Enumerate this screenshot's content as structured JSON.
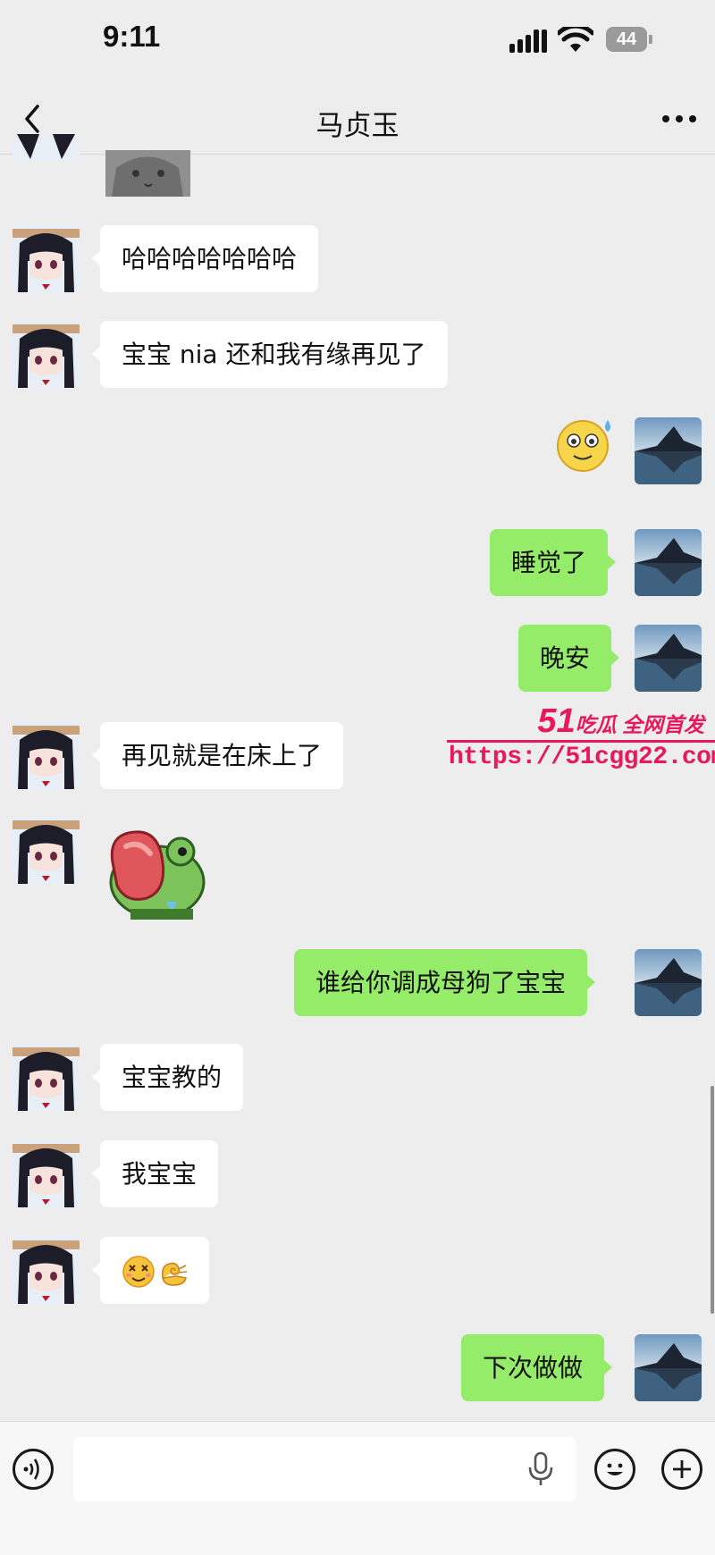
{
  "status_bar": {
    "time": "9:11",
    "battery": "44"
  },
  "header": {
    "title": "马贞玉"
  },
  "messages": [
    {
      "side": "in",
      "type": "text",
      "text": "哈哈哈哈哈哈哈"
    },
    {
      "side": "in",
      "type": "text",
      "text": "宝宝 nia 还和我有缘再见了"
    },
    {
      "side": "out",
      "type": "sticker",
      "sticker": "sweating-smile-emoji"
    },
    {
      "side": "out",
      "type": "text",
      "text": "睡觉了"
    },
    {
      "side": "out",
      "type": "text",
      "text": "晚安"
    },
    {
      "side": "in",
      "type": "text",
      "text": "再见就是在床上了"
    },
    {
      "side": "in",
      "type": "sticker",
      "sticker": "frog-tongue-sticker"
    },
    {
      "side": "out",
      "type": "text",
      "text": "谁给你调成母狗了宝宝"
    },
    {
      "side": "in",
      "type": "text",
      "text": "宝宝教的"
    },
    {
      "side": "in",
      "type": "text",
      "text": "我宝宝"
    },
    {
      "side": "in",
      "type": "sticker",
      "sticker": "dizzy-face-emoji + ok-hand-emoji"
    },
    {
      "side": "out",
      "type": "text",
      "text": "下次做做"
    }
  ],
  "watermark": {
    "brand_number": "51",
    "brand_text": "吃瓜 全网首发",
    "url": "https://51cgg22.com"
  },
  "colors": {
    "background": "#ededed",
    "incoming_bubble": "#ffffff",
    "outgoing_bubble": "#95ec69",
    "watermark": "#e8185a"
  }
}
